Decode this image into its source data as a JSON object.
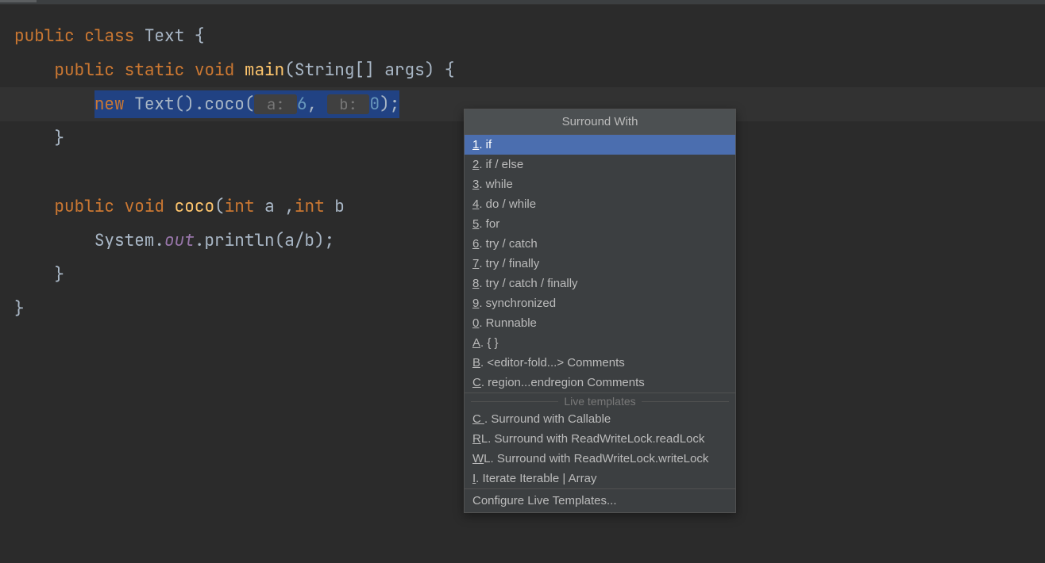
{
  "code": {
    "line1_public": "public",
    "line1_class": "class",
    "line1_name": "Text",
    "line1_brace": " {",
    "line2_indent": "    ",
    "line2_public": "public",
    "line2_static": "static",
    "line2_void": "void",
    "line2_main": "main",
    "line2_paren_open": "(",
    "line2_string": "String[] args",
    "line2_paren_close": ") {",
    "line3_indent": "        ",
    "line3_new": "new",
    "line3_text": " Text().coco(",
    "line3_hint_a": " a: ",
    "line3_val_a": "6",
    "line3_comma": ",",
    "line3_hint_b": " b: ",
    "line3_val_b": "0",
    "line3_close": ");",
    "line4": "    }",
    "line5": "",
    "line6_indent": "    ",
    "line6_public": "public",
    "line6_void": "void",
    "line6_coco": "coco",
    "line6_params_open": "(",
    "line6_int1": "int",
    "line6_a": " a ,",
    "line6_int2": "int",
    "line6_b": " b",
    "line7_indent": "        ",
    "line7_system": "System.",
    "line7_out": "out",
    "line7_println": ".println(a/b);",
    "line8": "    }",
    "line9": "}"
  },
  "popup": {
    "title": "Surround With",
    "items": [
      {
        "mnemonic": "1",
        "label": ". if"
      },
      {
        "mnemonic": "2",
        "label": ". if / else"
      },
      {
        "mnemonic": "3",
        "label": ". while"
      },
      {
        "mnemonic": "4",
        "label": ". do / while"
      },
      {
        "mnemonic": "5",
        "label": ". for"
      },
      {
        "mnemonic": "6",
        "label": ". try / catch"
      },
      {
        "mnemonic": "7",
        "label": ". try / finally"
      },
      {
        "mnemonic": "8",
        "label": ". try / catch / finally"
      },
      {
        "mnemonic": "9",
        "label": ". synchronized"
      },
      {
        "mnemonic": "0",
        "label": ". Runnable"
      },
      {
        "mnemonic": "A",
        "label": ". { }"
      },
      {
        "mnemonic": "B",
        "label": ". <editor-fold...> Comments"
      },
      {
        "mnemonic": "C",
        "label": ". region...endregion Comments"
      }
    ],
    "separator": "Live templates",
    "live_items": [
      {
        "mnemonic": "C ",
        "label": ". Surround with Callable"
      },
      {
        "mnemonic": "R",
        "label": "L. Surround with ReadWriteLock.readLock"
      },
      {
        "mnemonic": "W",
        "label": "L. Surround with ReadWriteLock.writeLock"
      },
      {
        "mnemonic": "I",
        "label": ". Iterate Iterable | Array"
      }
    ],
    "footer": "Configure Live Templates..."
  }
}
